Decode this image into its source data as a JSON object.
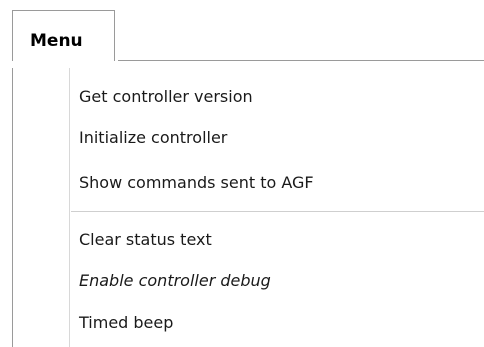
{
  "tab": {
    "label": "Menu"
  },
  "menu": {
    "group_1": [
      {
        "label": "Get controller version"
      },
      {
        "label": "Initialize controller"
      },
      {
        "label": "Show commands sent to AGF"
      }
    ],
    "group_2": [
      {
        "label": "Clear status text"
      },
      {
        "label": "Enable controller debug",
        "style": "italic"
      },
      {
        "label": "Timed beep"
      }
    ]
  }
}
